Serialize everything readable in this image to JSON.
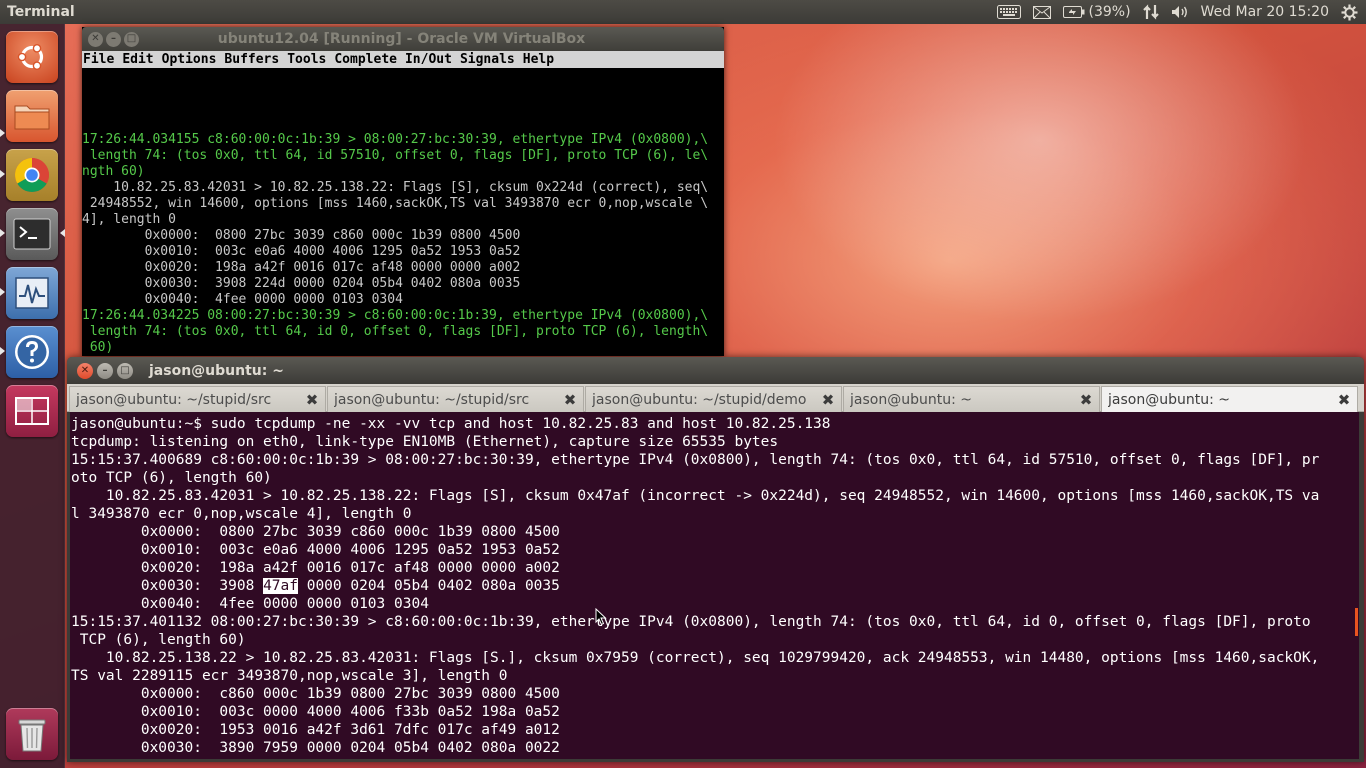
{
  "top_panel": {
    "app_title": "Terminal",
    "battery": "(39%)",
    "datetime": "Wed Mar 20 15:20"
  },
  "launcher": {
    "items": [
      "ubuntu-dash",
      "files",
      "chrome",
      "terminal",
      "system-monitor",
      "help",
      "workspace-switcher",
      "trash"
    ]
  },
  "vbox": {
    "title": "ubuntu12.04 [Running] - Oracle VM VirtualBox",
    "menu": [
      "File",
      "Edit",
      "Options",
      "Buffers",
      "Tools",
      "Complete",
      "In/Out",
      "Signals",
      "Help"
    ],
    "lines": [
      {
        "text": "17:26:44.034155 c8:60:00:0c:1b:39 > 08:00:27:bc:30:39, ethertype IPv4 (0x0800),\\",
        "color": "green"
      },
      {
        "text": " length 74: (tos 0x0, ttl 64, id 57510, offset 0, flags [DF], proto TCP (6), le\\",
        "color": "green"
      },
      {
        "text": "ngth 60)",
        "color": "green"
      },
      {
        "text": "    10.82.25.83.42031 > 10.82.25.138.22: Flags [S], cksum 0x224d (correct), seq\\",
        "color": "white"
      },
      {
        "text": " 24948552, win 14600, options [mss 1460,sackOK,TS val 3493870 ecr 0,nop,wscale \\",
        "color": "white"
      },
      {
        "text": "4], length 0",
        "color": "white"
      },
      {
        "text": "        0x0000:  0800 27bc 3039 c860 000c 1b39 0800 4500",
        "color": "white"
      },
      {
        "text": "        0x0010:  003c e0a6 4000 4006 1295 0a52 1953 0a52",
        "color": "white"
      },
      {
        "text": "        0x0020:  198a a42f 0016 017c af48 0000 0000 a002",
        "color": "white"
      },
      {
        "text": "        0x0030:  3908 224d 0000 0204 05b4 0402 080a 0035",
        "color": "white"
      },
      {
        "text": "        0x0040:  4fee 0000 0000 0103 0304",
        "color": "white"
      },
      {
        "text": "17:26:44.034225 08:00:27:bc:30:39 > c8:60:00:0c:1b:39, ethertype IPv4 (0x0800),\\",
        "color": "green"
      },
      {
        "text": " length 74: (tos 0x0, ttl 64, id 0, offset 0, flags [DF], proto TCP (6), length\\",
        "color": "green"
      },
      {
        "text": " 60)",
        "color": "green"
      }
    ]
  },
  "terminal": {
    "title": "jason@ubuntu: ~",
    "tabs": [
      {
        "label": "jason@ubuntu: ~/stupid/src",
        "active": false
      },
      {
        "label": "jason@ubuntu: ~/stupid/src",
        "active": false
      },
      {
        "label": "jason@ubuntu: ~/stupid/demo",
        "active": false
      },
      {
        "label": "jason@ubuntu: ~",
        "active": false
      },
      {
        "label": "jason@ubuntu: ~",
        "active": true
      }
    ],
    "lines": [
      "jason@ubuntu:~$ sudo tcpdump -ne -xx -vv tcp and host 10.82.25.83 and host 10.82.25.138",
      "tcpdump: listening on eth0, link-type EN10MB (Ethernet), capture size 65535 bytes",
      "15:15:37.400689 c8:60:00:0c:1b:39 > 08:00:27:bc:30:39, ethertype IPv4 (0x0800), length 74: (tos 0x0, ttl 64, id 57510, offset 0, flags [DF], pr",
      "oto TCP (6), length 60)",
      "    10.82.25.83.42031 > 10.82.25.138.22: Flags [S], cksum 0x47af (incorrect -> 0x224d), seq 24948552, win 14600, options [mss 1460,sackOK,TS va",
      "l 3493870 ecr 0,nop,wscale 4], length 0",
      "        0x0000:  0800 27bc 3039 c860 000c 1b39 0800 4500",
      "        0x0010:  003c e0a6 4000 4006 1295 0a52 1953 0a52",
      "        0x0020:  198a a42f 0016 017c af48 0000 0000 a002",
      "        0x0030:  3908 47af 0000 0204 05b4 0402 080a 0035",
      "        0x0040:  4fee 0000 0000 0103 0304",
      "15:15:37.401132 08:00:27:bc:30:39 > c8:60:00:0c:1b:39, ethertype IPv4 (0x0800), length 74: (tos 0x0, ttl 64, id 0, offset 0, flags [DF], proto",
      " TCP (6), length 60)",
      "    10.82.25.138.22 > 10.82.25.83.42031: Flags [S.], cksum 0x7959 (correct), seq 1029799420, ack 24948553, win 14480, options [mss 1460,sackOK,",
      "TS val 2289115 ecr 3493870,nop,wscale 3], length 0",
      "        0x0000:  c860 000c 1b39 0800 27bc 3039 0800 4500",
      "        0x0010:  003c 0000 4000 4006 f33b 0a52 198a 0a52",
      "        0x0020:  1953 0016 a42f 3d61 7dfc 017c af49 a012",
      "        0x0030:  3890 7959 0000 0204 05b4 0402 080a 0022"
    ],
    "highlight": {
      "line": 9,
      "text": "47af"
    }
  },
  "colors": {
    "terminal_bg": "#300a24",
    "accent": "#e95420",
    "vbox_green": "#55c94a"
  }
}
